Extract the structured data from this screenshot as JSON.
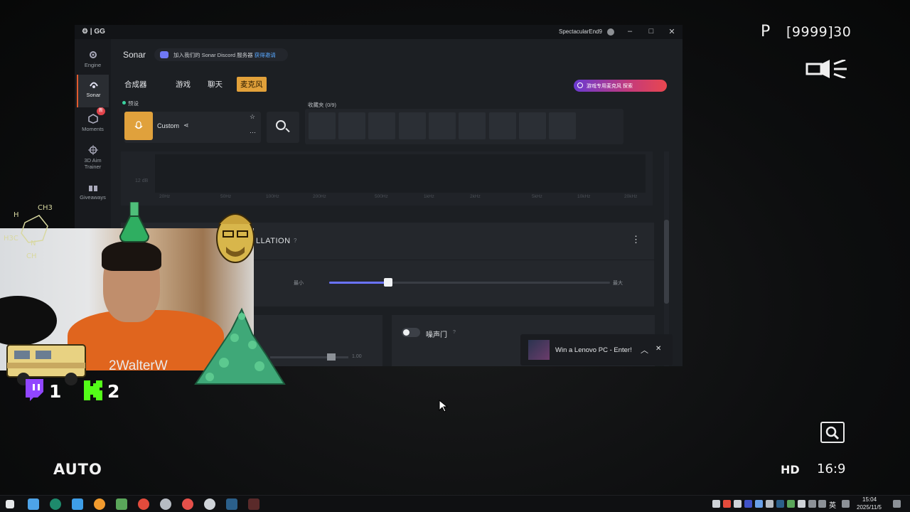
{
  "overlay": {
    "mode_letter": "P",
    "counter": "[9999]30",
    "auto_label": "AUTO",
    "hd_label": "HD",
    "ratio_label": "16:9"
  },
  "app": {
    "logo": "GG",
    "username": "SpectacularEnd9",
    "header_title": "Sonar",
    "discord_text": "加入我们的 Sonar Discord 服务器",
    "discord_link": "获得邀请"
  },
  "sidebar": {
    "items": [
      {
        "label": "Engine",
        "icon": "engine-icon"
      },
      {
        "label": "Sonar",
        "icon": "sonar-icon",
        "active": true
      },
      {
        "label": "Moments",
        "icon": "moments-icon",
        "badge": "新"
      },
      {
        "label": "3D Aim Trainer",
        "icon": "aim-icon"
      },
      {
        "label": "Giveaways",
        "icon": "gift-icon"
      }
    ]
  },
  "tabs": {
    "mixer": "合成器",
    "game": "游戏",
    "chat": "聊天",
    "mic": "麦克风"
  },
  "promo": {
    "label": "游戏专用麦克风  探索"
  },
  "presets": {
    "label": "预设",
    "name": "Custom",
    "favorites_label": "收藏夹 (0/9)"
  },
  "eq": {
    "db_label": "12 dB",
    "freqs": [
      "20Hz",
      "50Hz",
      "100Hz",
      "200Hz",
      "500Hz",
      "1kHz",
      "2kHz",
      "5kHz",
      "10kHz",
      "20kHz"
    ]
  },
  "noise_cancel": {
    "title": "LLATION",
    "help": "?",
    "min_label": "最小",
    "max_label": "最大",
    "level_percent": 21
  },
  "noise_gate": {
    "label": "噪声门",
    "help": "?",
    "value": "1.00",
    "enabled": false
  },
  "toast": {
    "text": "Win a Lenovo PC - Enter!"
  },
  "stream": {
    "name": "2WalterW",
    "twitch_count": "1",
    "kick_count": "2",
    "molecule_labels": [
      "H",
      "CH3",
      "H3C",
      "N",
      "CH"
    ]
  },
  "taskbar": {
    "time": "15:04",
    "date": "2025/11/5",
    "lang": "英"
  },
  "colors": {
    "accent": "#e2a13a",
    "slider": "#6a73ff",
    "active_border": "#e15a2e"
  }
}
